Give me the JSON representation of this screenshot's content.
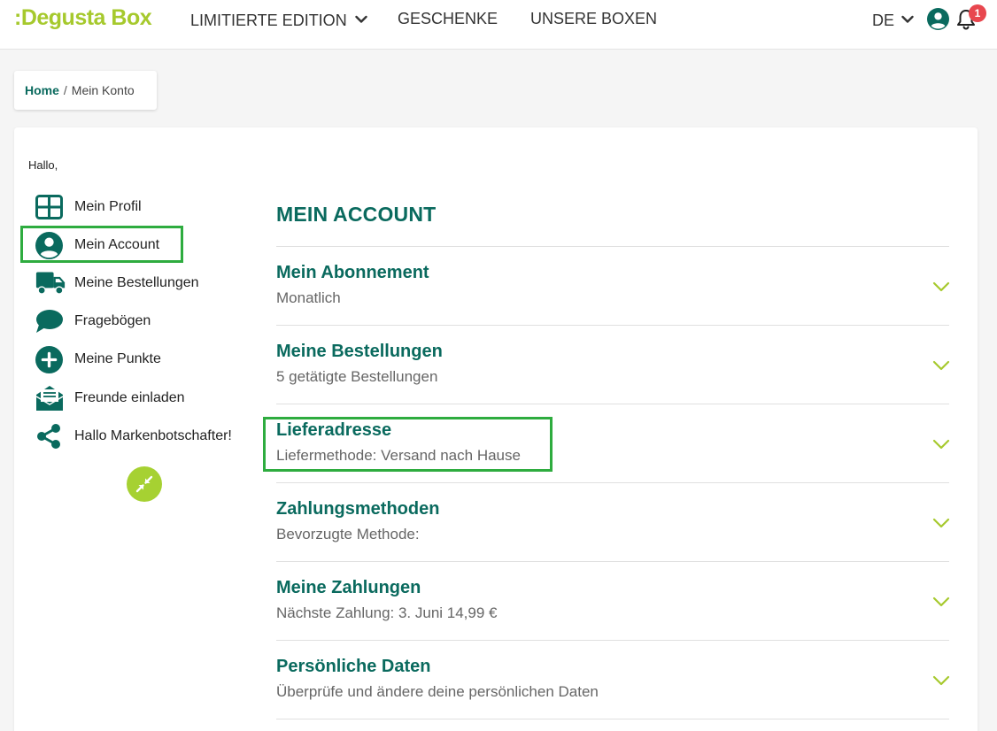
{
  "header": {
    "logo": ":Degusta Box",
    "nav": [
      {
        "label": "LIMITIERTE EDITION",
        "has_dropdown": true
      },
      {
        "label": "GESCHENKE",
        "has_dropdown": false
      },
      {
        "label": "UNSERE BOXEN",
        "has_dropdown": false
      }
    ],
    "language": "DE",
    "notification_count": "1"
  },
  "breadcrumb": {
    "home": "Home",
    "separator": "/",
    "current": "Mein Konto"
  },
  "greeting": "Hallo,",
  "sidebar": {
    "items": [
      {
        "label": "Mein Profil",
        "icon": "grid-icon"
      },
      {
        "label": "Mein Account",
        "icon": "user-circle-icon",
        "active": true
      },
      {
        "label": "Meine Bestellungen",
        "icon": "truck-icon"
      },
      {
        "label": "Fragebögen",
        "icon": "chat-bubble-icon"
      },
      {
        "label": "Meine Punkte",
        "icon": "plus-circle-icon"
      },
      {
        "label": "Freunde einladen",
        "icon": "envelope-letter-icon"
      },
      {
        "label": "Hallo Markenbotschafter!",
        "icon": "share-icon"
      }
    ],
    "collapse_icon": "collapse-arrows-icon"
  },
  "main": {
    "title": "MEIN ACCOUNT",
    "sections": [
      {
        "title": "Mein Abonnement",
        "subtitle": "Monatlich"
      },
      {
        "title": "Meine Bestellungen",
        "subtitle": "5 getätigte Bestellungen"
      },
      {
        "title": "Lieferadresse",
        "subtitle": "Liefermethode: Versand nach Hause"
      },
      {
        "title": "Zahlungsmethoden",
        "subtitle": "Bevorzugte Methode:"
      },
      {
        "title": "Meine Zahlungen",
        "subtitle": "Nächste Zahlung: 3. Juni 14,99 €"
      },
      {
        "title": "Persönliche Daten",
        "subtitle": "Überprüfe und ändere deine persönlichen Daten"
      }
    ]
  },
  "colors": {
    "brand_green": "#a6c92d",
    "dark_teal": "#0a6a5e",
    "highlight_green": "#2eac3f",
    "badge_red": "#e8474f"
  }
}
